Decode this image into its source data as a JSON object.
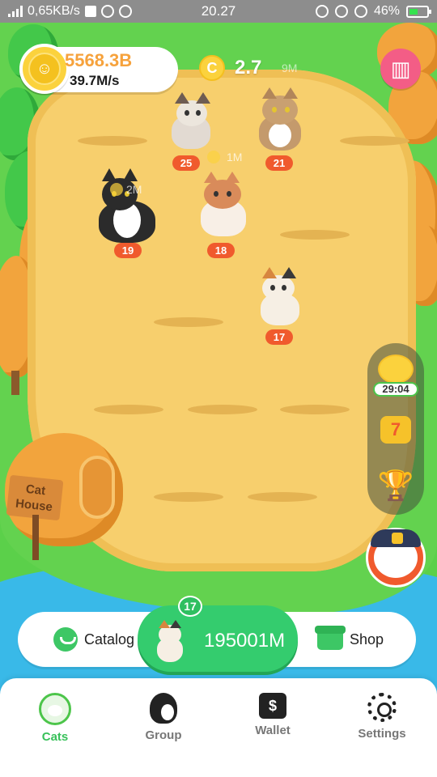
{
  "status_bar": {
    "network_speed": "0,65KB/s",
    "time": "20.27",
    "battery": "46%"
  },
  "game": {
    "balance": "5568.3B",
    "income_rate": "39.7M/s",
    "boost_multiplier": "2.7",
    "boost_ghost": "9M",
    "float_ghost_1": "1M",
    "float_ghost_2": "2M",
    "cats": [
      {
        "level": "25",
        "name": "siamese-cat"
      },
      {
        "level": "21",
        "name": "tabby-cat"
      },
      {
        "level": "19",
        "name": "tuxedo-cat"
      },
      {
        "level": "18",
        "name": "orange-white-cat"
      },
      {
        "level": "17",
        "name": "calico-cat"
      }
    ],
    "timer": "29:04",
    "house_sign": "Cat House"
  },
  "action_bar": {
    "catalog_label": "Catalog",
    "buy_price": "195001M",
    "buy_level": "17",
    "shop_label": "Shop"
  },
  "tabs": [
    {
      "label": "Cats",
      "icon": "cat-icon",
      "active": true
    },
    {
      "label": "Group",
      "icon": "group-icon",
      "active": false
    },
    {
      "label": "Wallet",
      "icon": "wallet-icon",
      "active": false
    },
    {
      "label": "Settings",
      "icon": "gear-icon",
      "active": false
    }
  ],
  "colors": {
    "grass": "#63d24f",
    "sand": "#f7cf6d",
    "accent_green": "#34cc6e",
    "level_badge": "#f05a2d",
    "balance_orange": "#f6a23c"
  }
}
